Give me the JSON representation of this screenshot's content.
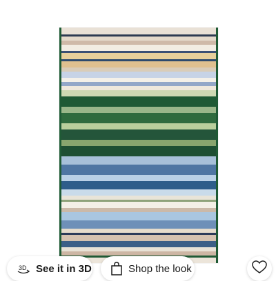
{
  "product_image": {
    "description_icon": "rug-product-photo",
    "stripe_colors": [
      "#e9e1d6",
      "#2d3b52",
      "#e4d9ca",
      "#cfb9a8",
      "#f2ece2",
      "#3a4f74",
      "#e7cf9b",
      "#2c4a6e",
      "#dfc08f",
      "#d9ccb8",
      "#c7d3e6",
      "#f4f0e8",
      "#93a7c8",
      "#efe8dc",
      "#cfd9b3",
      "#1f5a35",
      "#9ab78a",
      "#2f6b3e",
      "#b9cf9c",
      "#24553a",
      "#88a56e",
      "#1e4f33",
      "#a7c0d9",
      "#4f76a3",
      "#b9d0e6",
      "#2e5d8a",
      "#c9dbea",
      "#e8e4d8",
      "#8ea27a",
      "#f3efe6",
      "#cbb9a8",
      "#a9c6e0",
      "#6e90b8",
      "#e5dccc",
      "#2b3b59",
      "#d4c2b0",
      "#3c5f87",
      "#e8e2d6",
      "#cdb6a4",
      "#1f5a35",
      "#ece5da"
    ]
  },
  "actions": {
    "see_3d_label": "See it in 3D",
    "see_3d_icon": "3d-rotate-icon",
    "shop_look_label": "Shop the look",
    "shop_look_icon": "shopping-bag-icon",
    "favorite_icon": "heart-icon"
  },
  "colors": {
    "rug_edge": "#1f5a35",
    "pill_bg": "#ffffff",
    "text": "#1a1a1a"
  }
}
